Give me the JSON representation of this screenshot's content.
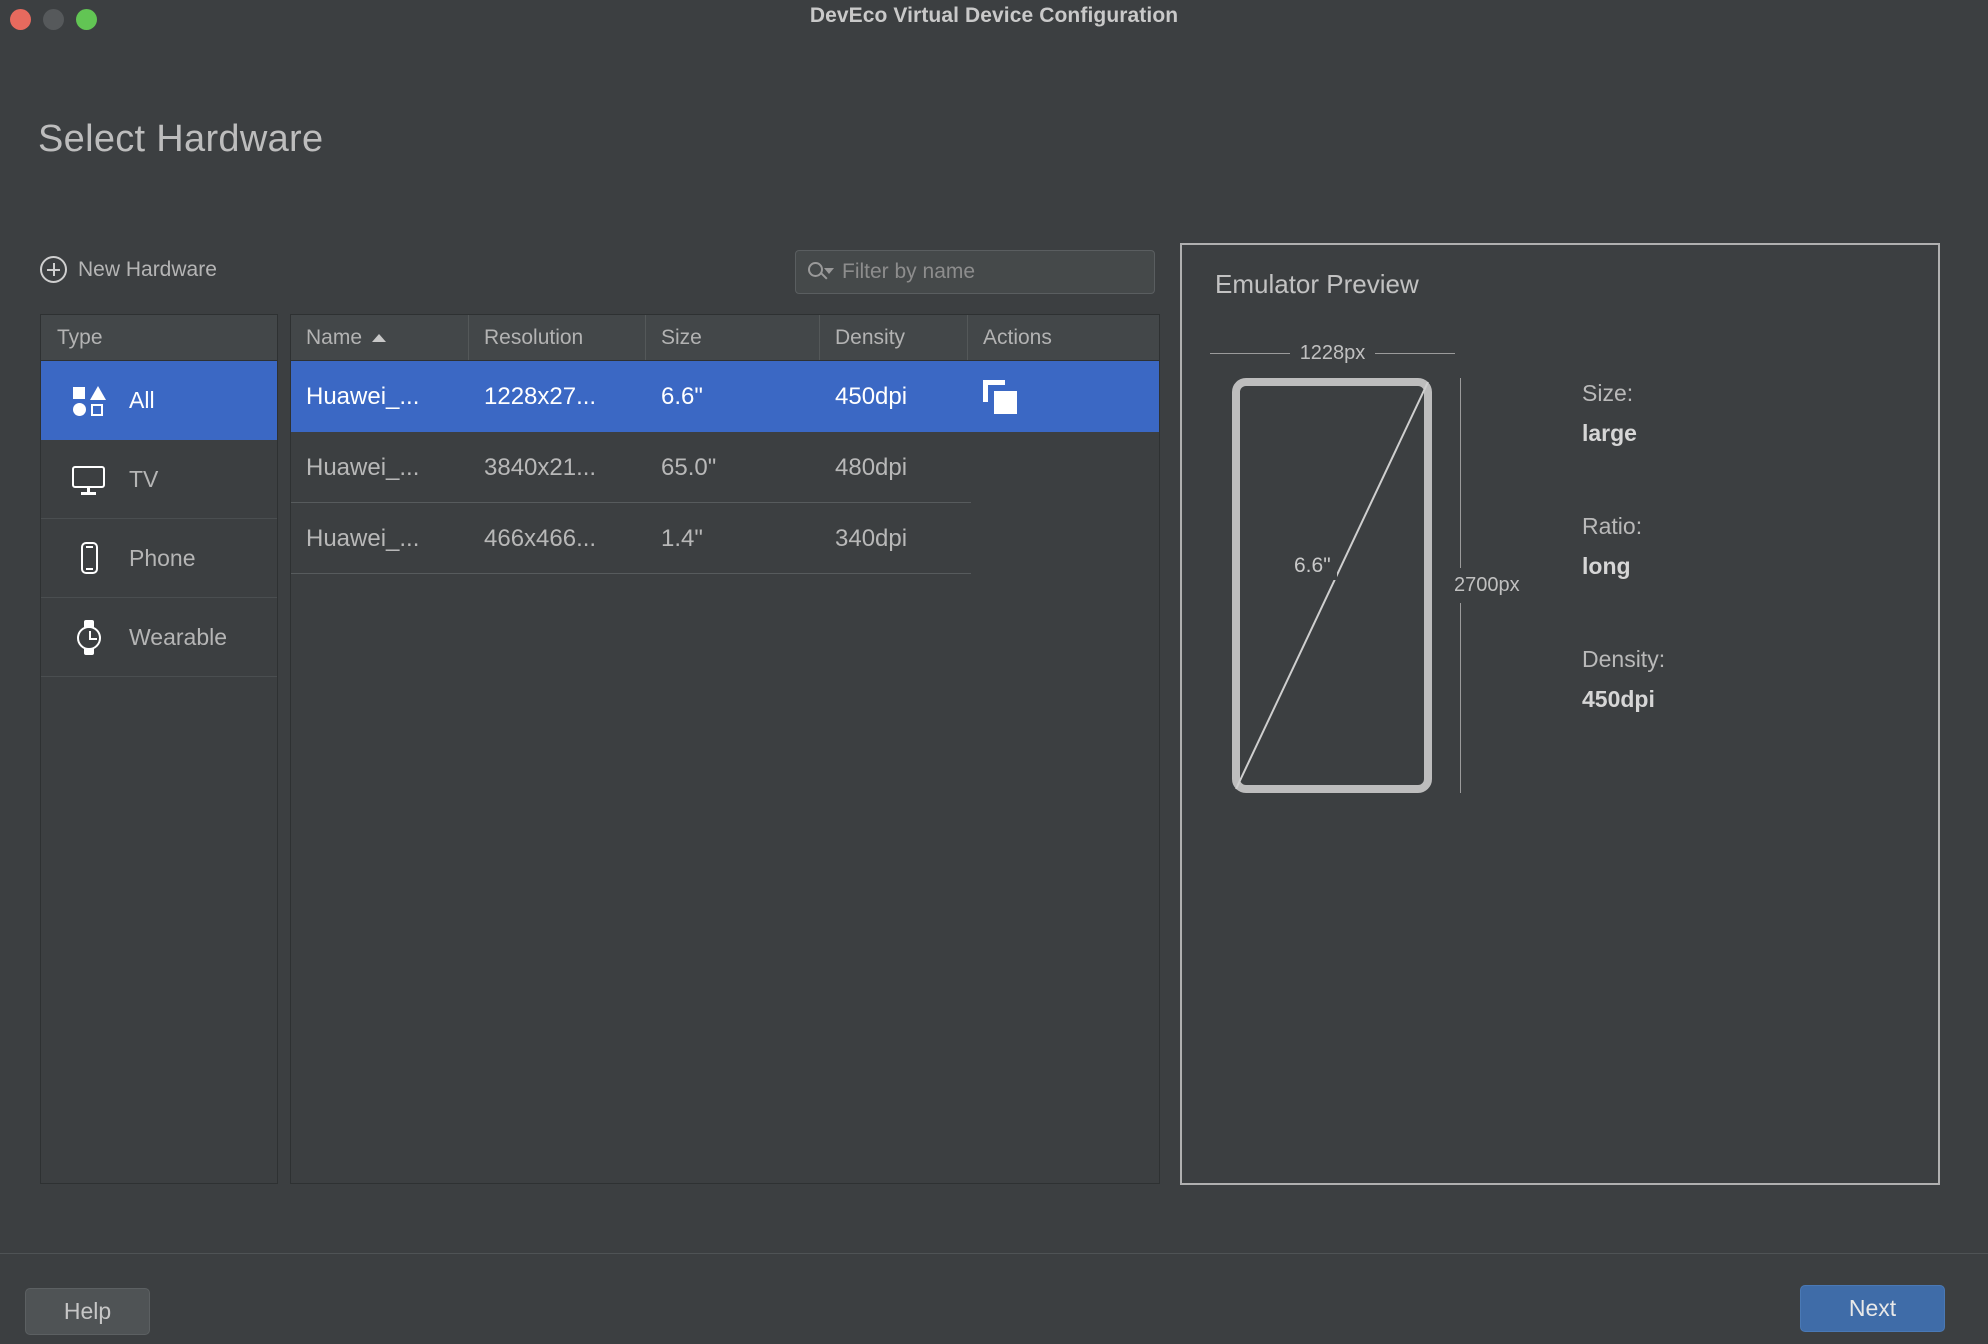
{
  "window": {
    "title": "DevEco Virtual Device Configuration",
    "traffic_lights": [
      "close",
      "minimize",
      "zoom"
    ]
  },
  "page": {
    "title": "Select Hardware"
  },
  "toolbar": {
    "new_hardware_label": "New Hardware",
    "filter": {
      "placeholder": "Filter by name",
      "value": ""
    }
  },
  "sidebar": {
    "header": "Type",
    "items": [
      {
        "label": "All",
        "icon": "shapes-grid-icon",
        "selected": true
      },
      {
        "label": "TV",
        "icon": "tv-icon",
        "selected": false
      },
      {
        "label": "Phone",
        "icon": "phone-icon",
        "selected": false
      },
      {
        "label": "Wearable",
        "icon": "watch-icon",
        "selected": false
      }
    ]
  },
  "table": {
    "columns": [
      "Name",
      "Resolution",
      "Size",
      "Density",
      "Actions"
    ],
    "sorted_by": "Name",
    "sort_direction": "ascending",
    "rows": [
      {
        "name": "Huawei_...",
        "resolution": "1228x27...",
        "size": "6.6\"",
        "density": "450dpi",
        "action_icon": "duplicate-icon",
        "selected": true
      },
      {
        "name": "Huawei_...",
        "resolution": "3840x21...",
        "size": "65.0\"",
        "density": "480dpi",
        "action_icon": "",
        "selected": false
      },
      {
        "name": "Huawei_...",
        "resolution": "466x466...",
        "size": "1.4\"",
        "density": "340dpi",
        "action_icon": "",
        "selected": false
      }
    ]
  },
  "preview": {
    "title": "Emulator Preview",
    "width_label": "1228px",
    "height_label": "2700px",
    "diagonal_label": "6.6\"",
    "specs": [
      {
        "label": "Size:",
        "value": "large"
      },
      {
        "label": "Ratio:",
        "value": "long"
      },
      {
        "label": "Density:",
        "value": "450dpi"
      }
    ]
  },
  "footer": {
    "help_label": "Help",
    "next_label": "Next"
  },
  "colors": {
    "background": "#3c3f41",
    "accent_selection": "#3b68c4",
    "primary_button": "#3f6ca8",
    "panel_border": "#b0b0b0",
    "text": "#b8b8b8"
  }
}
